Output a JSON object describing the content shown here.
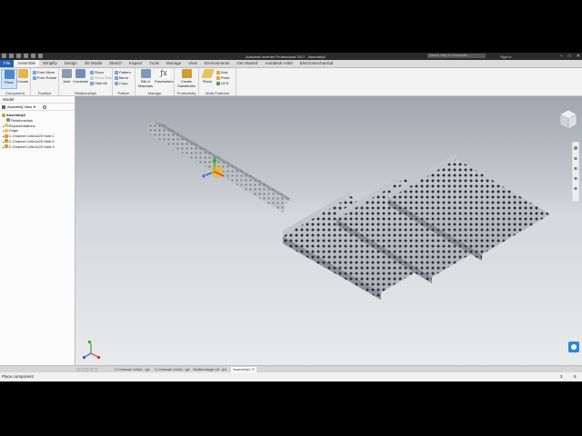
{
  "app": {
    "title": "Autodesk Inventor Professional 2017 - Assembly2",
    "search_placeholder": "Search Help & Commands...",
    "signin": "Sign In",
    "window_controls": [
      "–",
      "□",
      "✕"
    ]
  },
  "ribbon_tabs": [
    "File",
    "Assemble",
    "Simplify",
    "Design",
    "3D Model",
    "Sketch",
    "Inspect",
    "Tools",
    "Manage",
    "View",
    "Environments",
    "Get Started",
    "Autodesk A360",
    "Electromechanical"
  ],
  "active_tab": "Assemble",
  "ribbon": {
    "component": {
      "label": "Component",
      "place": "Place",
      "create": "Create"
    },
    "position": {
      "label": "Position",
      "free_move": "Free Move",
      "free_rotate": "Free Rotate"
    },
    "relationships": {
      "label": "Relationships",
      "joint": "Joint",
      "constrain": "Constrain",
      "show": "Show",
      "show_sick": "Show Sick",
      "hide_all": "Hide All"
    },
    "pattern": {
      "label": "Pattern",
      "pattern": "Pattern",
      "mirror": "Mirror",
      "copy": "Copy"
    },
    "manage": {
      "label": "Manage",
      "bom": "Bill of Materials",
      "parameters": "Parameters"
    },
    "productivity": {
      "label": "Productivity",
      "create_substitutes": "Create Substitutes"
    },
    "work_features": {
      "label": "Work Features",
      "plane": "Plane",
      "axis": "Axis",
      "point": "Point",
      "ucs": "UCS"
    }
  },
  "browser": {
    "header": "Model",
    "view_label": "Assembly View",
    "tree": [
      {
        "label": "Assembly2",
        "level": 0,
        "kind": "root"
      },
      {
        "label": "Relationships",
        "level": 1,
        "kind": "rel"
      },
      {
        "label": "Representations",
        "level": 1,
        "kind": "folder"
      },
      {
        "label": "Origin",
        "level": 1,
        "kind": "folder"
      },
      {
        "label": "C-Channel 1x5x1x25 Hole:1",
        "level": 1,
        "kind": "part"
      },
      {
        "label": "C-Channel 1x5x1x25 Hole:2",
        "level": 1,
        "kind": "part"
      },
      {
        "label": "C-Channel 1x5x1x25 Hole:3",
        "level": 1,
        "kind": "part"
      }
    ]
  },
  "document_tabs": [
    "C-Channel 1x5x1...ipt",
    "C-Channel 1x2x1...ipt",
    "Slotted Angle 16...ipt",
    "Assembly2"
  ],
  "active_document": "Assembly2",
  "status": {
    "text": "Place component",
    "num1": "3",
    "num2": "5"
  },
  "colors": {
    "file_tab": "#1f62b6",
    "part_hole": "#2a2d31",
    "grip_highlight": "#f2b21b"
  }
}
